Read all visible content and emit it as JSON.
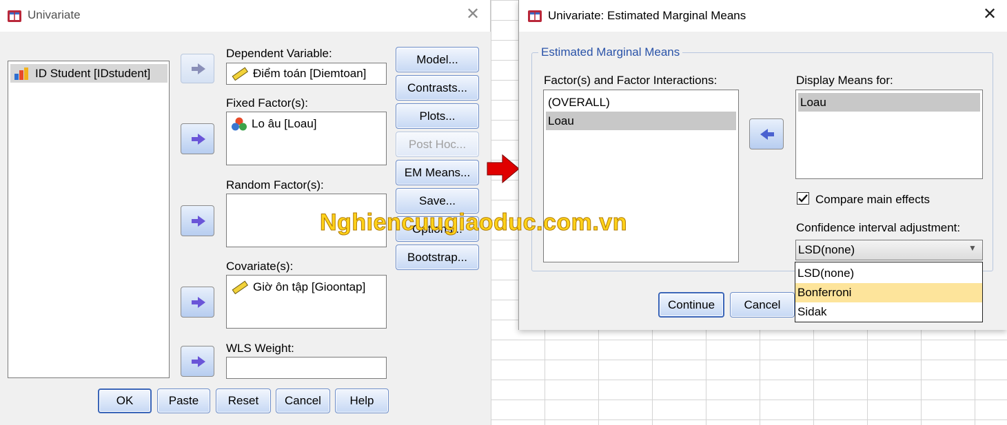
{
  "univariate": {
    "title": "Univariate",
    "variables": [
      "ID Student [IDstudent]"
    ],
    "dependent_label": "Dependent Variable:",
    "dependent_value": "Điểm toán [Diemtoan]",
    "fixed_label": "Fixed Factor(s):",
    "fixed_items": [
      "Lo âu [Loau]"
    ],
    "random_label": "Random Factor(s):",
    "covariate_label": "Covariate(s):",
    "covariate_items": [
      "Giờ ôn tập [Gioontap]"
    ],
    "wls_label": "WLS Weight:",
    "side_buttons": [
      "Model...",
      "Contrasts...",
      "Plots...",
      "Post Hoc...",
      "EM Means...",
      "Save...",
      "Options...",
      "Bootstrap..."
    ],
    "bottom_buttons": [
      "OK",
      "Paste",
      "Reset",
      "Cancel",
      "Help"
    ]
  },
  "emm": {
    "title": "Univariate: Estimated Marginal Means",
    "group_label": "Estimated Marginal Means",
    "factors_label": "Factor(s) and Factor Interactions:",
    "factors": [
      "(OVERALL)",
      "Loau"
    ],
    "display_label": "Display Means for:",
    "display_items": [
      "Loau"
    ],
    "compare_label": "Compare main effects",
    "compare_checked": true,
    "ci_label": "Confidence interval adjustment:",
    "ci_selected": "LSD(none)",
    "ci_options": [
      "LSD(none)",
      "Bonferroni",
      "Sidak"
    ],
    "continue_label": "Continue",
    "cancel_label": "Cancel"
  },
  "watermark": "Nghiencuugiaoduc.com.vn",
  "colors": {
    "accent": "#3a65b8",
    "arrow": "#e00000",
    "watermark": "#ffd21a",
    "highlight": "#fde49b"
  }
}
